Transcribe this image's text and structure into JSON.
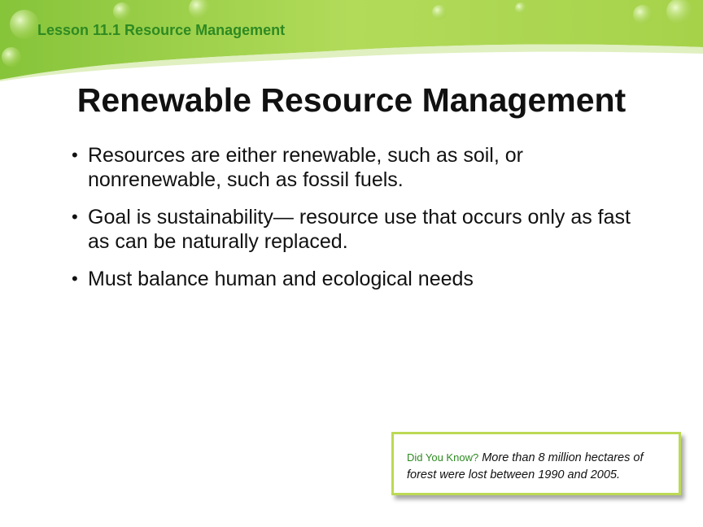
{
  "header": {
    "lesson": "Lesson 11.1 Resource Management"
  },
  "slide": {
    "title": "Renewable Resource Management",
    "bullets": [
      "Resources are either renewable, such as soil, or nonrenewable, such as fossil fuels.",
      "Goal is sustainability— resource use that occurs only as fast as can be naturally replaced.",
      "Must balance human and ecological needs"
    ]
  },
  "did_you_know": {
    "label": "Did You Know?",
    "fact": "More than 8 million hectares of forest were lost between 1990 and 2005."
  },
  "colors": {
    "accent_green": "#2e8a22",
    "banner_green": "#9fd13c",
    "box_border": "#bcd955"
  }
}
